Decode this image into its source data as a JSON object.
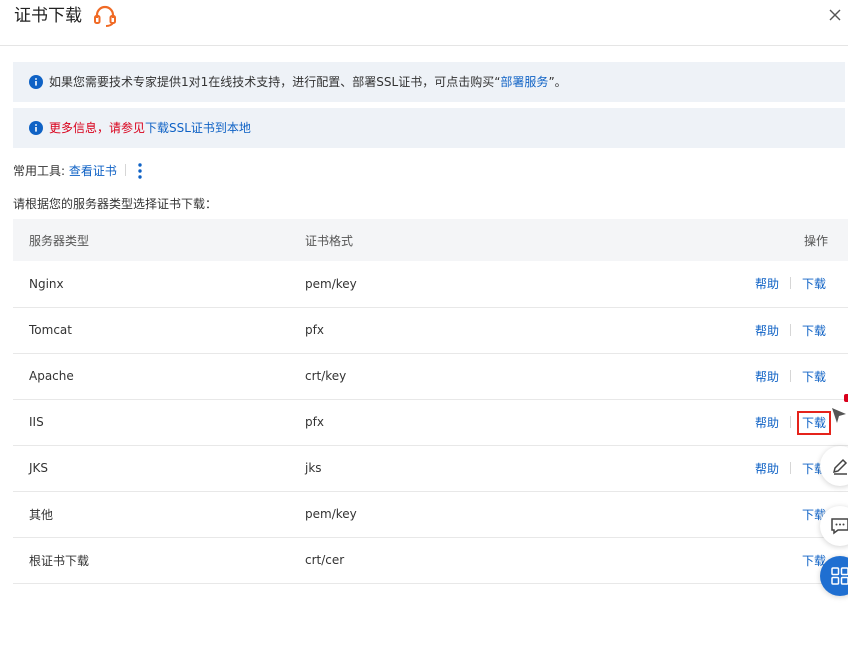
{
  "dialog": {
    "title": "证书下载"
  },
  "notices": {
    "consult": {
      "text_before": "如果您需要技术专家提供1对1在线技术支持，进行配置、部署SSL证书，可点击购买“",
      "link": "部署服务",
      "text_after": "”。"
    },
    "more_info": {
      "text_before": "更多信息，请参见",
      "link": "下载SSL证书到本地"
    }
  },
  "tools": {
    "label": "常用工具:",
    "view_cert": "查看证书"
  },
  "instruction": "请根据您的服务器类型选择证书下载：",
  "table": {
    "headers": [
      "服务器类型",
      "证书格式",
      "操作"
    ],
    "help_label": "帮助",
    "download_label": "下载",
    "rows": [
      {
        "server": "Nginx",
        "format": "pem/key"
      },
      {
        "server": "Tomcat",
        "format": "pfx"
      },
      {
        "server": "Apache",
        "format": "crt/key"
      },
      {
        "server": "IIS",
        "format": "pfx"
      },
      {
        "server": "JKS",
        "format": "jks"
      },
      {
        "server": "其他",
        "format": "pem/key"
      },
      {
        "server": "根证书下载",
        "format": "crt/cer"
      }
    ]
  },
  "colors": {
    "link": "#0f62c5",
    "warning": "#d9001b",
    "notice_bg": "#eef2f7",
    "highlight": "#e5231b",
    "support_icon": "#f06a25"
  },
  "icons": [
    "headset-icon",
    "close-icon",
    "info-icon",
    "more-vertical-icon",
    "pin-icon",
    "edit-icon",
    "chat-icon",
    "apps-icon"
  ]
}
